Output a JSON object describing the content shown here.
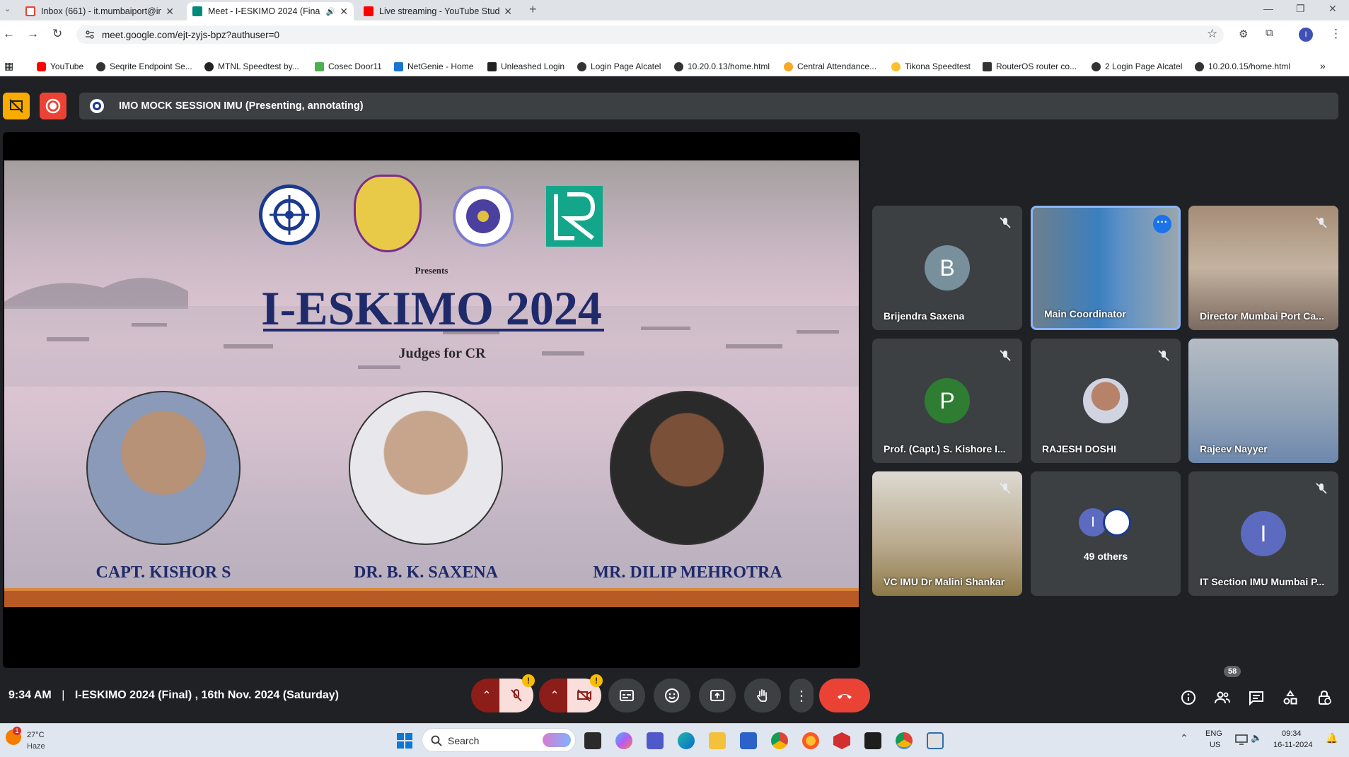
{
  "browser": {
    "tabs": [
      {
        "title": "Inbox (661) - it.mumbaiport@in",
        "favicon_color": "#ea4335"
      },
      {
        "title": "Meet - I-ESKIMO 2024 (Fina",
        "favicon_color": "#00897b",
        "active": true
      },
      {
        "title": "Live streaming - YouTube Studi",
        "favicon_color": "#ff0000"
      }
    ],
    "new_tab": "+",
    "url": "meet.google.com/ejt-zyjs-bpz?authuser=0",
    "profile_initial": "I",
    "bookmarks": [
      {
        "label": "YouTube",
        "color": "#ff0000"
      },
      {
        "label": "Seqrite Endpoint Se...",
        "color": "#333"
      },
      {
        "label": "MTNL Speedtest by...",
        "color": "#222"
      },
      {
        "label": "Cosec Door11",
        "color": "#4caf50"
      },
      {
        "label": "NetGenie - Home",
        "color": "#1976d2"
      },
      {
        "label": "Unleashed Login",
        "color": "#222"
      },
      {
        "label": "Login Page Alcatel",
        "color": "#333"
      },
      {
        "label": "10.20.0.13/home.html",
        "color": "#333"
      },
      {
        "label": "Central Attendance...",
        "color": "#f9a825"
      },
      {
        "label": "Tikona Speedtest",
        "color": "#fbc02d"
      },
      {
        "label": "RouterOS router co...",
        "color": "#333"
      },
      {
        "label": "2 Login Page Alcatel",
        "color": "#333"
      },
      {
        "label": "10.20.0.15/home.html",
        "color": "#333"
      }
    ]
  },
  "meet": {
    "presentation_label": "IMO MOCK SESSION IMU (Presenting, annotating)",
    "slide": {
      "presents": "Presents",
      "title": "I-ESKIMO 2024",
      "subtitle": "Judges for CR",
      "judges": [
        "CAPT. KISHOR S",
        "DR. B. K. SAXENA",
        "MR. DILIP MEHROTRA"
      ]
    },
    "participants": [
      {
        "name": "Brijendra Saxena",
        "initial": "B",
        "color": "#78909c",
        "muted": true
      },
      {
        "name": "Main Coordinator",
        "video": true,
        "speaking": true
      },
      {
        "name": "Director Mumbai Port Ca...",
        "video": true,
        "muted": true
      },
      {
        "name": "Prof. (Capt.) S. Kishore I...",
        "initial": "P",
        "color": "#2e7d32",
        "muted": true
      },
      {
        "name": "RAJESH DOSHI",
        "photo": true,
        "muted": true
      },
      {
        "name": "Rajeev Nayyer",
        "video": true
      },
      {
        "name": "VC IMU Dr Malini Shankar",
        "video": true,
        "muted": true
      },
      {
        "name": "49 others",
        "initial": "I",
        "color": "#5c6bc0"
      },
      {
        "name": "IT Section IMU Mumbai P...",
        "initial": "I",
        "color": "#5c6bc0",
        "muted": true
      }
    ],
    "time": "9:34 AM",
    "separator": "|",
    "meeting_title": "I-ESKIMO 2024 (Final) , 16th Nov. 2024 (Saturday)",
    "people_count": "58",
    "warn": "!"
  },
  "taskbar": {
    "weather_temp": "27°C",
    "weather_desc": "Haze",
    "weather_badge": "1",
    "search_label": "Search",
    "lang": "ENG",
    "region": "US",
    "clock_time": "09:34",
    "clock_date": "16-11-2024"
  }
}
